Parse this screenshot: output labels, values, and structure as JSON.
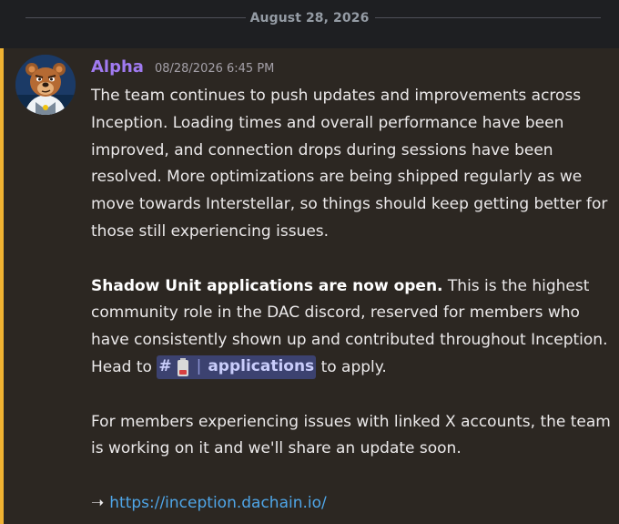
{
  "date_divider": {
    "label": "August 28, 2026"
  },
  "message": {
    "author": "Alpha",
    "timestamp": "08/28/2026 6:45 PM",
    "paragraph1": "The team continues to push updates and improvements across Inception. Loading times and overall performance have been improved, and connection drops during sessions have been resolved. More optimizations are being shipped regularly as we move towards Interstellar, so things should keep getting better for those still experiencing issues.",
    "paragraph2_bold": "Shadow Unit applications are now open.",
    "paragraph2_rest": " This is the highest community role in the DAC discord, reserved for members who have consistently shown up and contributed throughout Inception. Head to ",
    "channel": {
      "hash": "#",
      "separator": "|",
      "name": "applications"
    },
    "paragraph2_end": " to apply.",
    "paragraph3": "For members experiencing issues with linked X accounts, the team is working on it and we'll share an update soon.",
    "link_arrow": "➝",
    "link_text": "https://inception.dachain.io/"
  },
  "colors": {
    "author": "#a07af0",
    "highlight_bar": "#f0b232",
    "link": "#4fa6e8",
    "mention_bg": "#3c4270"
  },
  "icons": [
    "bear-avatar",
    "battery-icon"
  ]
}
